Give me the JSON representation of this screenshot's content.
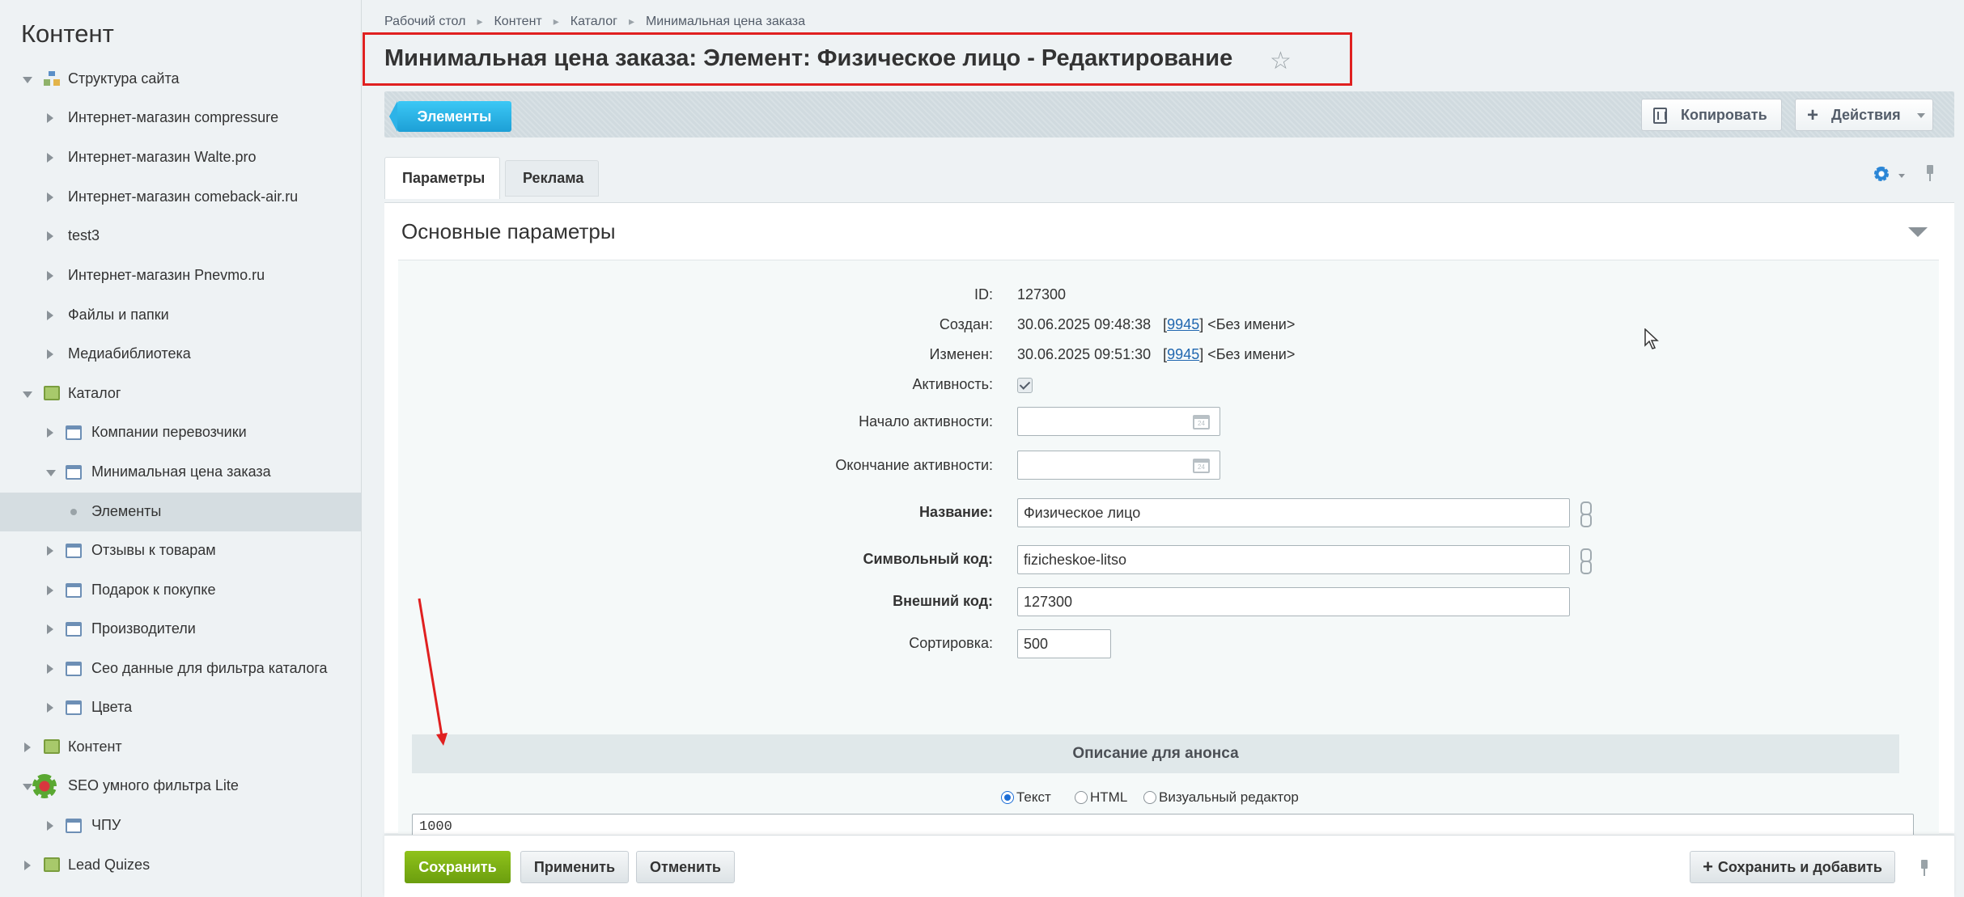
{
  "sidebar": {
    "title": "Контент",
    "items": [
      {
        "label": "Структура сайта"
      },
      {
        "label": "Интернет-магазин compressure"
      },
      {
        "label": "Интернет-магазин Walte.pro"
      },
      {
        "label": "Интернет-магазин comeback-air.ru"
      },
      {
        "label": "test3"
      },
      {
        "label": "Интернет-магазин Pnevmo.ru"
      },
      {
        "label": "Файлы и папки"
      },
      {
        "label": "Медиабиблиотека"
      },
      {
        "label": "Каталог"
      },
      {
        "label": "Компании перевозчики"
      },
      {
        "label": "Минимальная цена заказа"
      },
      {
        "label": "Элементы"
      },
      {
        "label": "Отзывы к товарам"
      },
      {
        "label": "Подарок к покупке"
      },
      {
        "label": "Производители"
      },
      {
        "label": "Сео данные для фильтра каталога"
      },
      {
        "label": "Цвета"
      },
      {
        "label": "Контент"
      },
      {
        "label": "SEO умного фильтра Lite"
      },
      {
        "label": "ЧПУ"
      },
      {
        "label": "Lead Quizes"
      }
    ]
  },
  "breadcrumb": [
    "Рабочий стол",
    "Контент",
    "Каталог",
    "Минимальная цена заказа"
  ],
  "page": {
    "title": "Минимальная цена заказа: Элемент: Физическое лицо - Редактирование"
  },
  "toolbar": {
    "elements_label": "Элементы",
    "copy_label": "Копировать",
    "actions_label": "Действия"
  },
  "tabs": [
    {
      "label": "Параметры"
    },
    {
      "label": "Реклама"
    }
  ],
  "section": {
    "title": "Основные параметры"
  },
  "form": {
    "id_label": "ID:",
    "id_value": "127300",
    "created_label": "Создан:",
    "created_date": "30.06.2025 09:48:38",
    "created_user_id": "9945",
    "created_user_name": "<Без имени>",
    "modified_label": "Изменен:",
    "modified_date": "30.06.2025 09:51:30",
    "modified_user_id": "9945",
    "modified_user_name": "<Без имени>",
    "active_label": "Активность:",
    "active_checked": true,
    "active_from_label": "Начало активности:",
    "active_from_value": "",
    "active_to_label": "Окончание активности:",
    "active_to_value": "",
    "name_label": "Название:",
    "name_value": "Физическое лицо",
    "code_label": "Символьный код:",
    "code_value": "fizicheskoe-litso",
    "xml_id_label": "Внешний код:",
    "xml_id_value": "127300",
    "sort_label": "Сортировка:",
    "sort_value": "500"
  },
  "preview": {
    "header": "Описание для анонса",
    "type_options": [
      "Текст",
      "HTML",
      "Визуальный редактор"
    ],
    "type_selected": "Текст",
    "text": "1000"
  },
  "footer": {
    "save_label": "Сохранить",
    "apply_label": "Применить",
    "cancel_label": "Отменить",
    "save_add_label": "Сохранить и добавить"
  },
  "calendar_glyph": "24",
  "colors": {
    "accent_blue": "#1d9fd6",
    "save_green": "#6b9e0e",
    "highlight_red": "#e02020"
  }
}
